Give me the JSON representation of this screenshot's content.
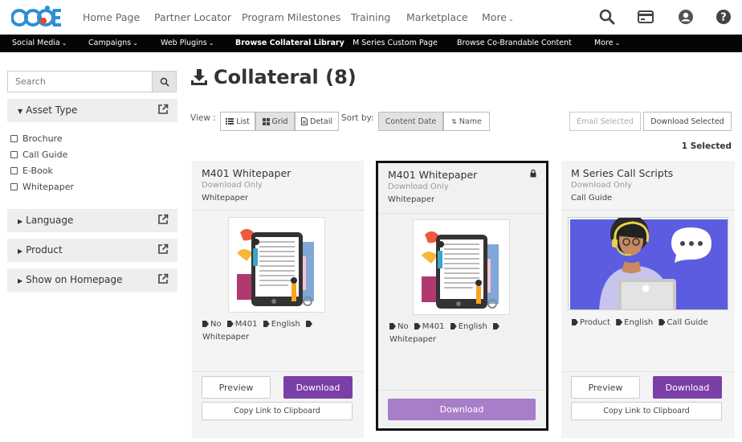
{
  "top_nav": {
    "links": [
      "Home Page",
      "Partner Locator",
      "Program Milestones",
      "Training",
      "Marketplace",
      "More"
    ],
    "icons": [
      "search-icon",
      "credit-card-icon",
      "account-icon",
      "help-icon"
    ]
  },
  "sub_nav": {
    "links": [
      "Social Media",
      "Campaigns",
      "Web Plugins",
      "Browse Collateral Library",
      "M Series Custom Page",
      "Browse Co-Brandable Content",
      "More"
    ]
  },
  "sidebar": {
    "search_placeholder": "Search",
    "facets": [
      {
        "label": "Asset Type",
        "expanded": true,
        "options": [
          "Brochure",
          "Call Guide",
          "E-Book",
          "Whitepaper"
        ]
      },
      {
        "label": "Language",
        "expanded": false
      },
      {
        "label": "Product",
        "expanded": false
      },
      {
        "label": "Show on Homepage",
        "expanded": false
      }
    ]
  },
  "main": {
    "title": "Collateral (8)",
    "view_label": "View :",
    "view_options": [
      "List",
      "Grid",
      "Detail"
    ],
    "active_view": "Grid",
    "sort_label": "Sort by:",
    "sort_options": [
      "Content Date",
      "Name"
    ],
    "active_sort": "Content Date",
    "email_selected": "Email Selected",
    "download_selected": "Download Selected",
    "selected_count": "1 Selected"
  },
  "cards": [
    {
      "title": "M401 Whitepaper",
      "subtitle": "Download Only",
      "type": "Whitepaper",
      "tags": [
        "No",
        "M401",
        "English",
        "Whitepaper"
      ],
      "preview": "Preview",
      "download": "Download",
      "copy": "Copy Link to Clipboard",
      "selected": false
    },
    {
      "title": "M401 Whitepaper",
      "subtitle": "Download Only",
      "type": "Whitepaper",
      "tags": [
        "No",
        "M401",
        "English",
        "Whitepaper"
      ],
      "download": "Download",
      "selected": true
    },
    {
      "title": "M Series Call Scripts",
      "subtitle": "Download Only",
      "type": "Call Guide",
      "tags": [
        "Product",
        "English",
        "Call Guide"
      ],
      "preview": "Preview",
      "download": "Download",
      "copy": "Copy Link to Clipboard",
      "selected": false
    }
  ],
  "colors": {
    "accent": "#7b3fa8",
    "accent_disabled": "#a97ec9",
    "sub_nav_bg": "#050505",
    "logo_blue": "#2a8fd6"
  }
}
